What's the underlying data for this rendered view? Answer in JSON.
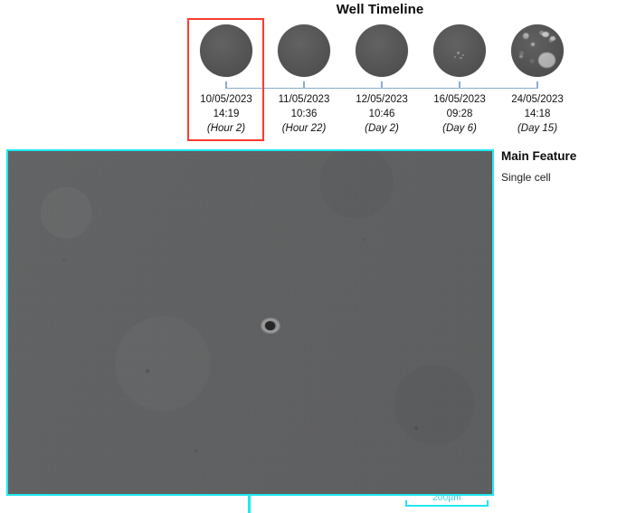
{
  "timeline": {
    "title": "Well Timeline",
    "selected_index": 0,
    "selection_color": "#ff3b30",
    "axis_color": "#8aacd0",
    "items": [
      {
        "date": "10/05/2023",
        "time": "14:19",
        "relative": "(Hour 2)",
        "thumbnail": "well-thumbnail-empty",
        "selected": true
      },
      {
        "date": "11/05/2023",
        "time": "10:36",
        "relative": "(Hour 22)",
        "thumbnail": "well-thumbnail-empty",
        "selected": false
      },
      {
        "date": "12/05/2023",
        "time": "10:46",
        "relative": "(Day 2)",
        "thumbnail": "well-thumbnail-empty",
        "selected": false
      },
      {
        "date": "16/05/2023",
        "time": "09:28",
        "relative": "(Day 6)",
        "thumbnail": "well-thumbnail-specks",
        "selected": false
      },
      {
        "date": "24/05/2023",
        "time": "14:18",
        "relative": "(Day 15)",
        "thumbnail": "well-thumbnail-colony",
        "selected": false
      }
    ]
  },
  "main_image": {
    "highlight_color": "#20e8f0",
    "scale_bar": {
      "label": "200µm"
    },
    "feature_marker": "single-cell"
  },
  "side_info": {
    "title": "Main Feature",
    "value": "Single cell"
  }
}
